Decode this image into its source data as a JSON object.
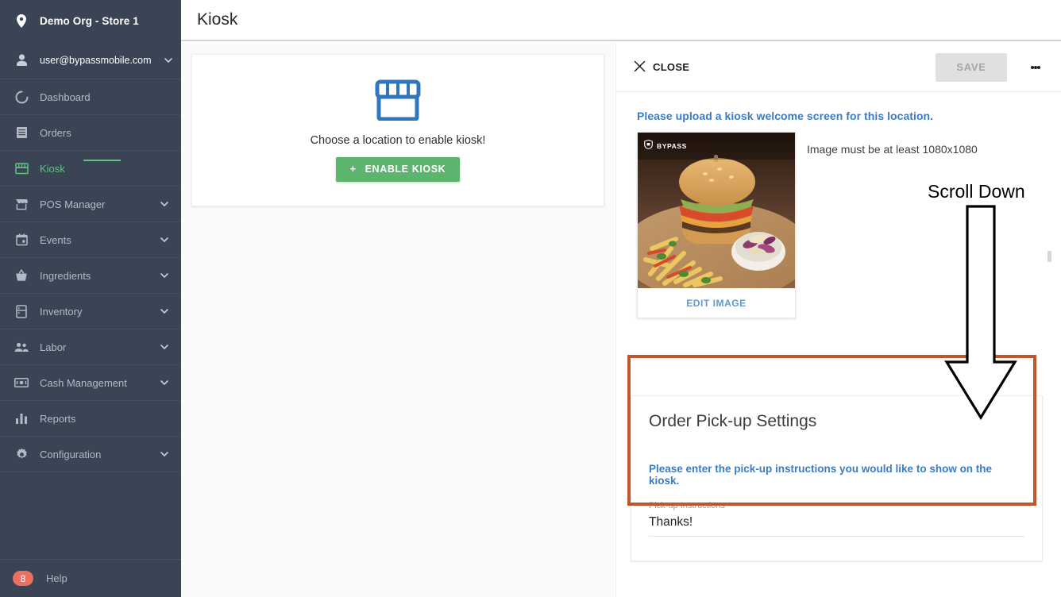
{
  "sidebar": {
    "org": {
      "icon": "location-pin-icon",
      "label": "Demo Org - Store 1"
    },
    "user": {
      "icon": "person-icon",
      "label": "user@bypassmobile.com",
      "chevron": "chevron-down-icon"
    },
    "items": [
      {
        "icon": "dashboard-icon",
        "label": "Dashboard",
        "expandable": false,
        "active": false
      },
      {
        "icon": "orders-icon",
        "label": "Orders",
        "expandable": false,
        "active": false
      },
      {
        "icon": "kiosk-store-icon",
        "label": "Kiosk",
        "expandable": false,
        "active": true
      },
      {
        "icon": "pos-manager-icon",
        "label": "POS Manager",
        "expandable": true,
        "active": false
      },
      {
        "icon": "calendar-icon",
        "label": "Events",
        "expandable": true,
        "active": false
      },
      {
        "icon": "basket-icon",
        "label": "Ingredients",
        "expandable": true,
        "active": false
      },
      {
        "icon": "inventory-icon",
        "label": "Inventory",
        "expandable": true,
        "active": false
      },
      {
        "icon": "people-icon",
        "label": "Labor",
        "expandable": true,
        "active": false
      },
      {
        "icon": "cash-icon",
        "label": "Cash Management",
        "expandable": true,
        "active": false
      },
      {
        "icon": "bar-chart-icon",
        "label": "Reports",
        "expandable": false,
        "active": false
      },
      {
        "icon": "gear-icon",
        "label": "Configuration",
        "expandable": true,
        "active": false
      }
    ],
    "help": {
      "badge": "8",
      "label": "Help"
    }
  },
  "header": {
    "title": "Kiosk"
  },
  "empty_state": {
    "icon": "storefront-icon",
    "message": "Choose a location to enable kiosk!",
    "button_label": "ENABLE KIOSK",
    "button_plus": "+"
  },
  "detail_panel": {
    "close_label": "CLOSE",
    "close_icon": "close-icon",
    "save_label": "SAVE",
    "menu_icon": "kebab-menu-icon",
    "upload_note": "Please upload a kiosk welcome screen for this location.",
    "image": {
      "watermark": "BYPASS",
      "watermark_icon": "shield-icon",
      "edit_label": "EDIT IMAGE"
    },
    "image_requirement": "Image must be at least 1080x1080",
    "pickup": {
      "title": "Order Pick-up Settings",
      "note": "Please enter the pick-up instructions you would like to show on the kiosk.",
      "field_label": "Pick-up Instructions *",
      "field_value": "Thanks!"
    }
  },
  "annotation": {
    "label": "Scroll Down",
    "arrow_icon": "down-arrow-outline-icon",
    "highlight_color": "#c1562a"
  },
  "colors": {
    "sidebar_bg": "#3a4454",
    "accent_green": "#63c280",
    "link_blue": "#3b7cc4",
    "badge_red": "#ec7060",
    "annotation_orange": "#c1562a"
  }
}
